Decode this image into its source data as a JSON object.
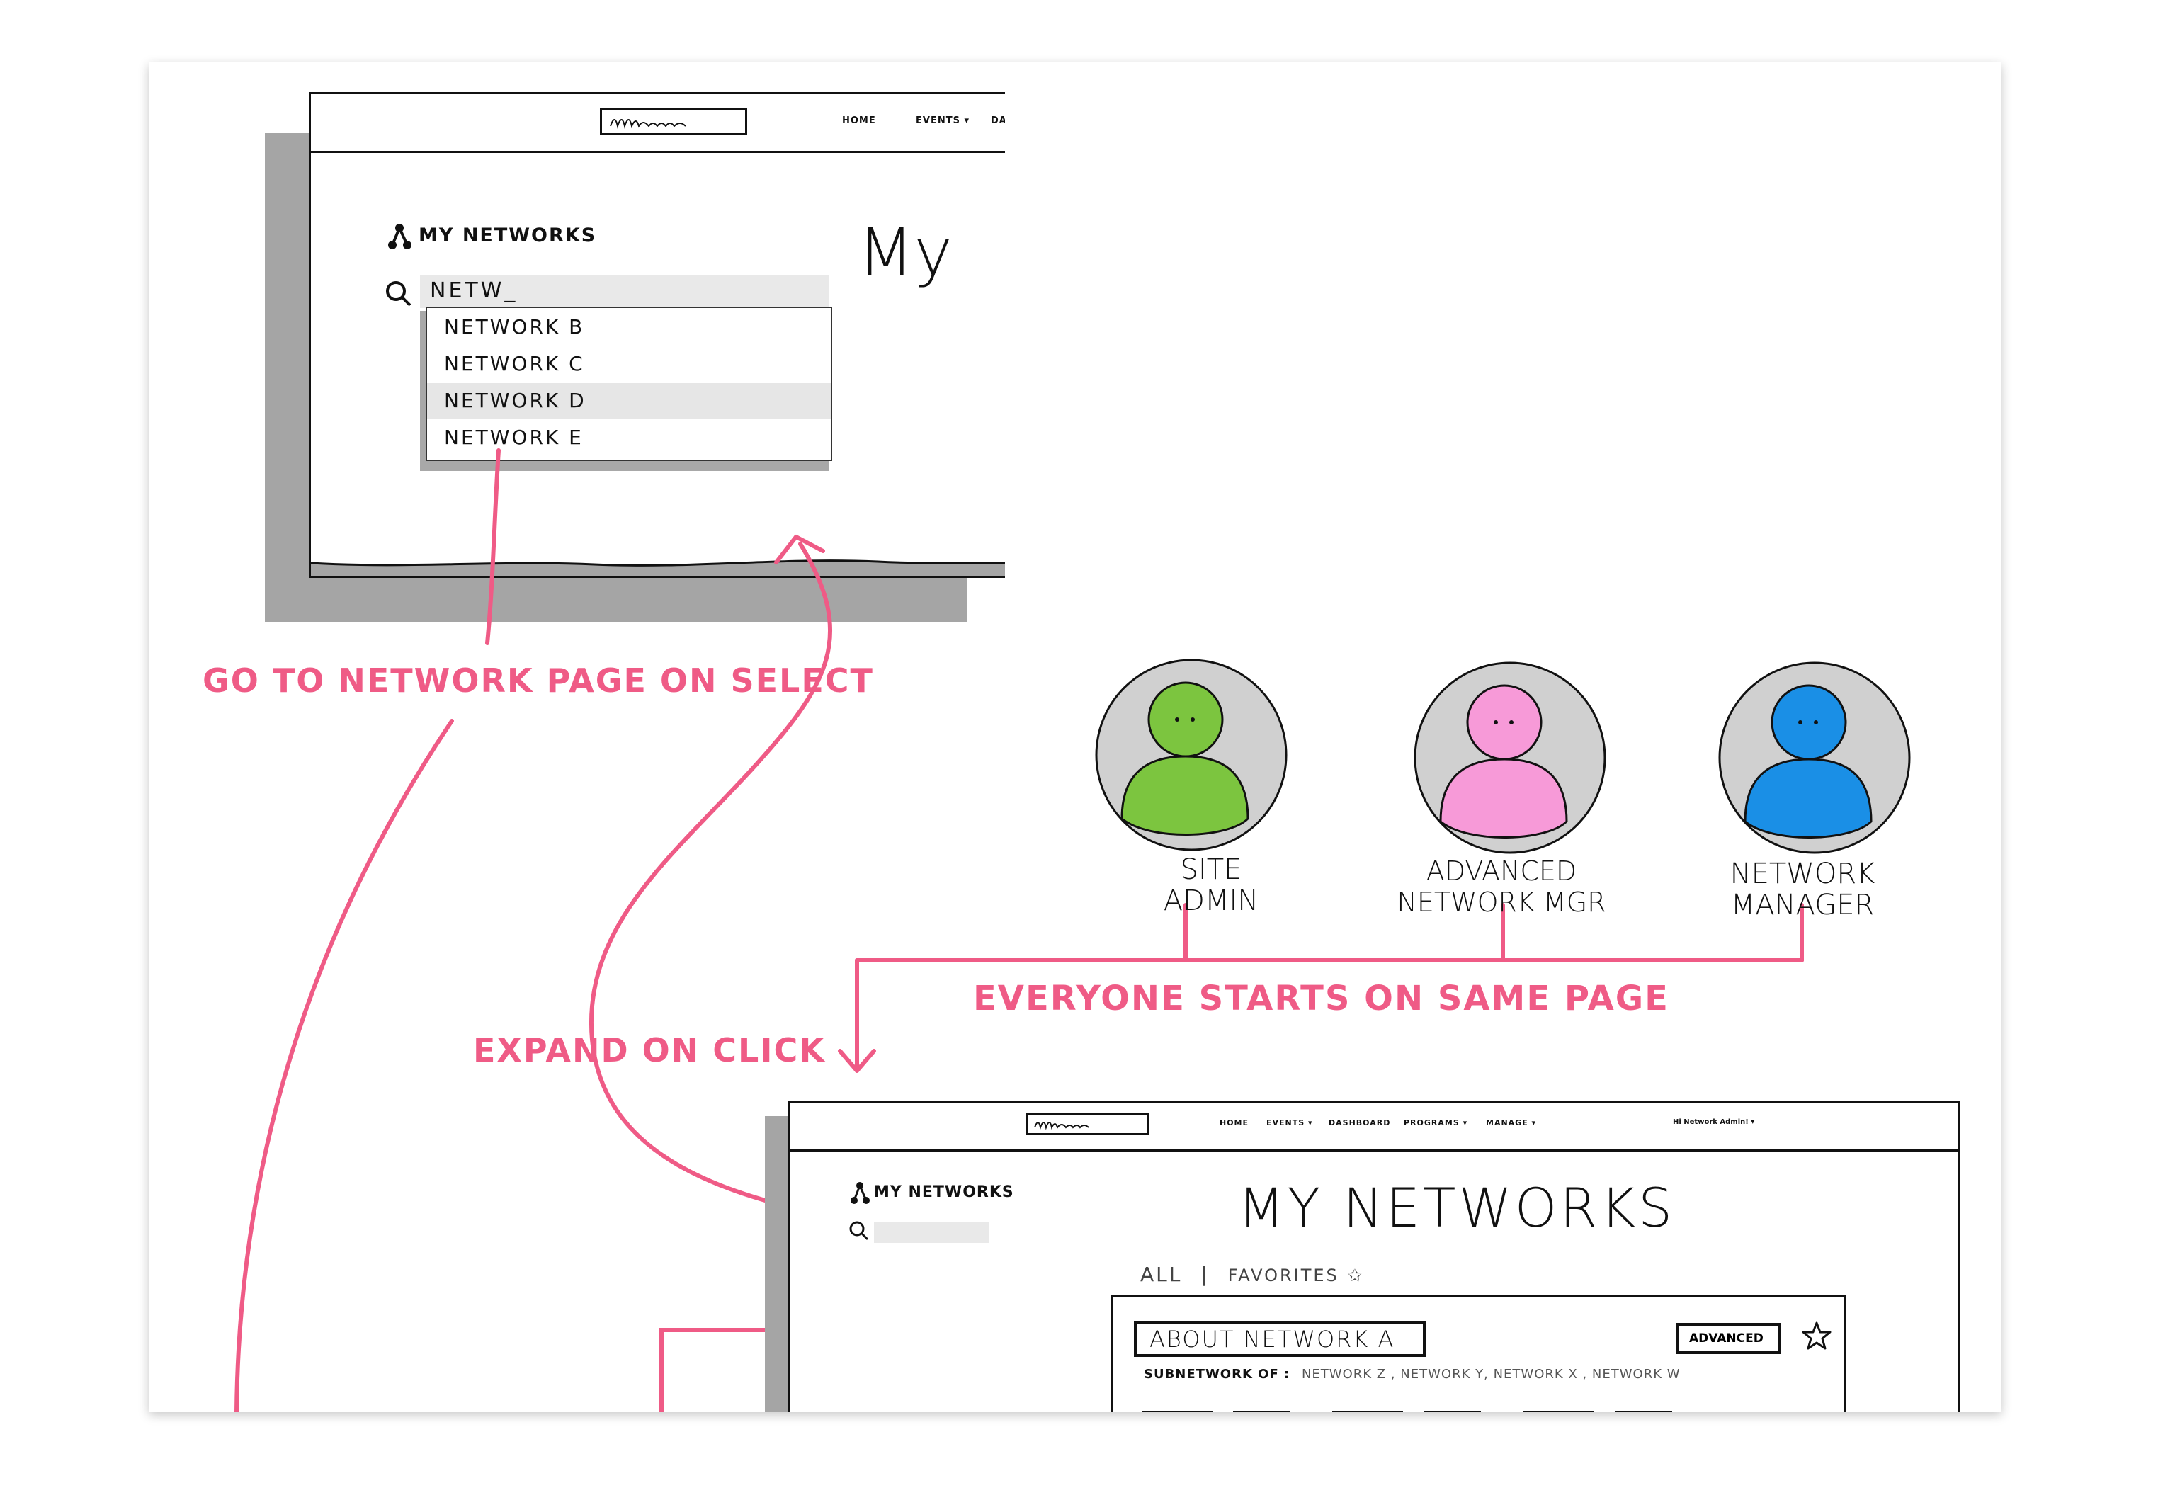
{
  "top_mockup": {
    "nav": {
      "home": "HOME",
      "events": "EVENTS ▾",
      "dash": "DASH"
    },
    "sidebar_title": "MY NETWORKS",
    "search_value": "NETW_",
    "dropdown_items": [
      "NETWORK B",
      "NETWORK C",
      "NETWORK D",
      "NETWORK E"
    ],
    "page_heading": "My"
  },
  "annotations": {
    "go_to_network": "GO TO NETWORK PAGE ON SELECT",
    "expand_on_click": "EXPAND ON CLICK",
    "everyone_starts": "EVERYONE STARTS ON SAME PAGE"
  },
  "personas": [
    {
      "line1": "SITE",
      "line2": "ADMIN",
      "color": "#7cc53f",
      "shade": "#5a9a2c"
    },
    {
      "line1": "ADVANCED",
      "line2": "NETWORK MGR",
      "color": "#f79ad8",
      "shade": "#c77ab0"
    },
    {
      "line1": "NETWORK",
      "line2": "MANAGER",
      "color": "#1a8fe6",
      "shade": "#0f6cb3"
    }
  ],
  "bottom_mockup": {
    "nav": {
      "home": "HOME",
      "events": "EVENTS ▾",
      "dashboard": "DASHBOARD",
      "programs": "PROGRAMS ▾",
      "manage": "MANAGE ▾",
      "user": "Hi Network Admin! ▾"
    },
    "sidebar_title": "MY NETWORKS",
    "page_heading": "MY NETWORKS",
    "filter_all": "ALL",
    "filter_sep": "|",
    "filter_favorites": "FAVORITES",
    "card": {
      "title": "ABOUT NETWORK A",
      "badge": "ADVANCED",
      "subnetwork_label": "SUBNETWORK OF :",
      "subnetworks": "NETWORK Z , NETWORK Y, NETWORK X , NETWORK W"
    }
  }
}
